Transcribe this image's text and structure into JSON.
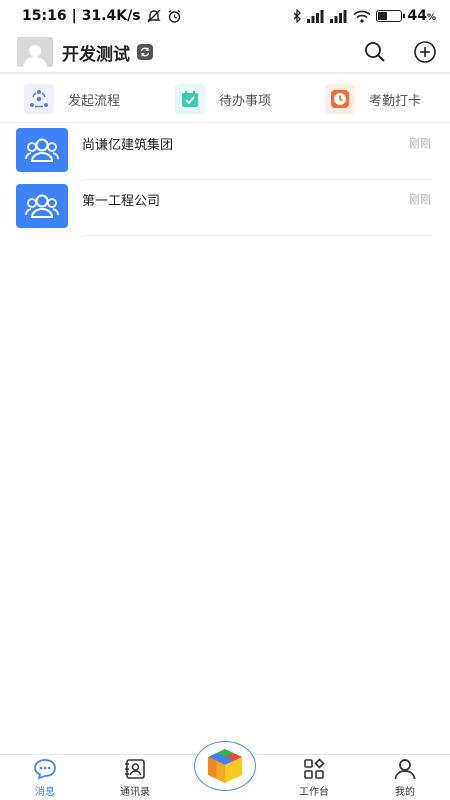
{
  "status_bar": {
    "time": "15:16",
    "speed": "31.4K/s",
    "battery_percent_text": "44",
    "battery_percent_sign": "%",
    "battery_level": 0.44
  },
  "header": {
    "title": "开发测试"
  },
  "quick_actions": [
    {
      "label": "发起流程",
      "icon": "flow-icon",
      "color": "#6b7bd6"
    },
    {
      "label": "待办事项",
      "icon": "calendar-check-icon",
      "color": "#3ec9b6"
    },
    {
      "label": "考勤打卡",
      "icon": "clock-icon",
      "color": "#f26b3a"
    }
  ],
  "conversations": [
    {
      "name": "尚谦亿建筑集团",
      "time": "刚刚",
      "icon": "group-icon"
    },
    {
      "name": "第一工程公司",
      "time": "刚刚",
      "icon": "group-icon"
    }
  ],
  "bottom_nav": {
    "items": [
      {
        "label": "消息",
        "icon": "chat-icon",
        "active": true
      },
      {
        "label": "通讯录",
        "icon": "contacts-icon",
        "active": false
      },
      {
        "label": "工作台",
        "icon": "workbench-icon",
        "active": false
      },
      {
        "label": "我的",
        "icon": "profile-icon",
        "active": false
      }
    ],
    "center_icon": "app-cube-icon"
  },
  "colors": {
    "accent": "#3e82f7"
  }
}
